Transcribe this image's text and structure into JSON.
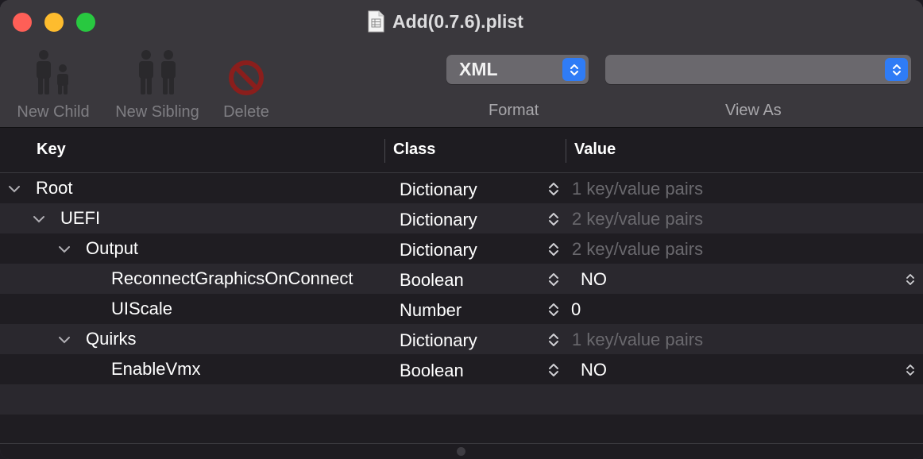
{
  "window": {
    "title": "Add(0.7.6).plist"
  },
  "toolbar": {
    "new_child_label": "New Child",
    "new_sibling_label": "New Sibling",
    "delete_label": "Delete",
    "format": {
      "value": "XML",
      "label": "Format"
    },
    "view_as": {
      "value": "",
      "label": "View As"
    }
  },
  "table": {
    "headers": {
      "key": "Key",
      "class": "Class",
      "value": "Value"
    },
    "rows": [
      {
        "key": "Root",
        "class": "Dictionary",
        "value": "1 key/value pairs"
      },
      {
        "key": "UEFI",
        "class": "Dictionary",
        "value": "2 key/value pairs"
      },
      {
        "key": "Output",
        "class": "Dictionary",
        "value": "2 key/value pairs"
      },
      {
        "key": "ReconnectGraphicsOnConnect",
        "class": "Boolean",
        "value": "NO"
      },
      {
        "key": "UIScale",
        "class": "Number",
        "value": "0"
      },
      {
        "key": "Quirks",
        "class": "Dictionary",
        "value": "1 key/value pairs"
      },
      {
        "key": "EnableVmx",
        "class": "Boolean",
        "value": "NO"
      }
    ]
  },
  "colors": {
    "accent": "#2f7cf6",
    "close": "#fe5f57",
    "minimize": "#febc2e",
    "maximize": "#28c840"
  }
}
